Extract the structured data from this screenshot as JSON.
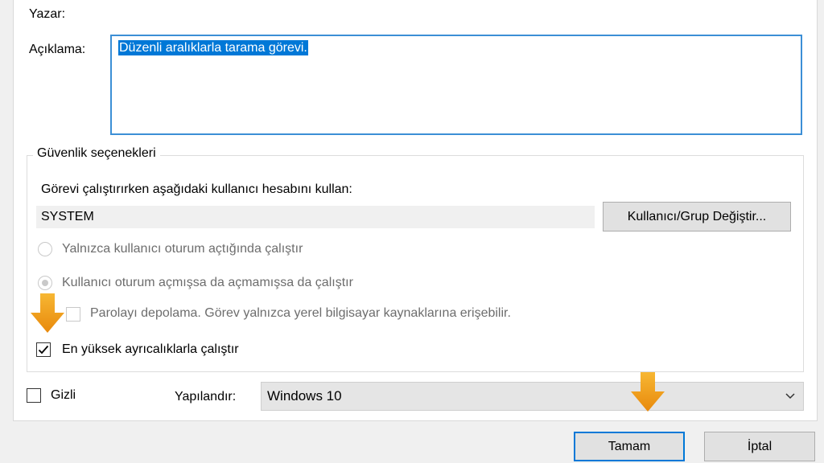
{
  "general": {
    "author_label": "Yazar:",
    "description_label": "Açıklama:",
    "description_value": "Düzenli aralıklarla tarama görevi."
  },
  "security": {
    "group_title": "Güvenlik seçenekleri",
    "account_prompt": "Görevi çalıştırırken aşağıdaki kullanıcı hesabını kullan:",
    "account_value": "SYSTEM",
    "change_user_button": "Kullanıcı/Grup Değiştir...",
    "radio_logged_on": "Yalnızca kullanıcı oturum açtığında çalıştır",
    "radio_whether_logged": "Kullanıcı oturum açmışsa da açmamışsa da çalıştır",
    "radio_logged_on_checked": false,
    "radio_whether_logged_checked": true,
    "no_store_password": "Parolayı depolama. Görev yalnızca yerel bilgisayar kaynaklarına erişebilir.",
    "no_store_password_checked": false,
    "highest_privileges": "En yüksek ayrıcalıklarla çalıştır",
    "highest_privileges_checked": true
  },
  "footer": {
    "hidden_label": "Gizli",
    "hidden_checked": false,
    "configure_label": "Yapılandır:",
    "configure_value": "Windows 10",
    "ok_button": "Tamam",
    "cancel_button": "İptal"
  },
  "colors": {
    "accent": "#0078d7",
    "annotation_arrow": "#f5a623"
  },
  "icons": {
    "check": "check-icon",
    "dropdown": "chevron-down-icon",
    "annotation": "orange-arrow-down-icon"
  }
}
